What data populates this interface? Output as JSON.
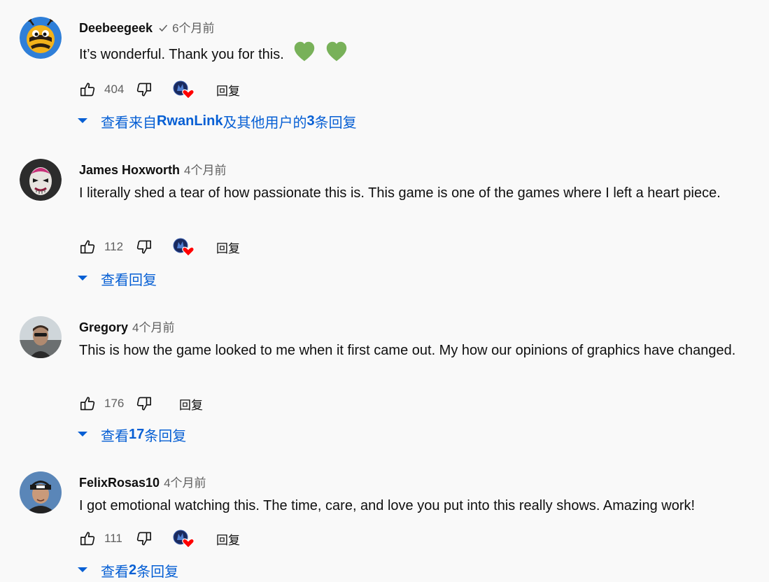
{
  "comments": [
    {
      "author": "Deebeegeek",
      "verified": true,
      "time": "6个月前",
      "text": "It’s wonderful. Thank you for this.",
      "emoji": "💚 💚",
      "likes": "404",
      "creator_heart": true,
      "reply_label": "回复",
      "replies": {
        "prefix": "查看来自",
        "bold": "RwanLink",
        "suffix": "及其他用户的 ",
        "count": "3",
        "unit": " 条回复"
      },
      "avatar": "bee-icon"
    },
    {
      "author": "James Hoxworth",
      "verified": false,
      "time": "4个月前",
      "text": "I literally shed a tear of how passionate this is. This game is one of the games where I left a heart piece.",
      "likes": "112",
      "creator_heart": true,
      "reply_label": "回复",
      "replies": {
        "prefix": "查看回复"
      },
      "avatar": "clown-mask-icon"
    },
    {
      "author": "Gregory",
      "verified": false,
      "time": "4个月前",
      "text": "This is how the game looked to me when it first came out. My how our opinions of graphics have changed.",
      "likes": "176",
      "creator_heart": false,
      "reply_label": "回复",
      "replies": {
        "prefix": "查看 ",
        "count": "17",
        "unit": " 条回复"
      },
      "avatar": "person-photo-icon"
    },
    {
      "author": "FelixRosas10",
      "verified": false,
      "time": "4个月前",
      "text": "I got emotional watching this. The time, care, and love you put into this really shows. Amazing work!",
      "likes": "111",
      "creator_heart": true,
      "reply_label": "回复",
      "replies": {
        "prefix": "查看 ",
        "count": "2",
        "unit": " 条回复"
      },
      "avatar": "person-cap-icon"
    }
  ],
  "colors": {
    "link": "#065fd4",
    "secondary_text": "#606060",
    "heart": "#ff0000",
    "emoji_heart": "#78b159",
    "background": "#f9f9f9"
  }
}
